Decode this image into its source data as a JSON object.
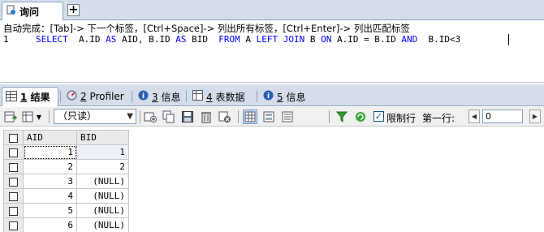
{
  "editor": {
    "tab_label": "询问",
    "new_tab_symbol": "+",
    "hint": "自动完成：[Tab]-> 下一个标签，[Ctrl+Space]-> 列出所有标签，[Ctrl+Enter]-> 列出匹配标签",
    "line_number": "1",
    "sql": {
      "t1": "SELECT",
      "t2": "  A.ID ",
      "t3": "AS",
      "t4": " AID, B.ID ",
      "t5": "AS",
      "t6": " BID  ",
      "t7": "FROM",
      "t8": " A ",
      "t9": "LEFT JOIN",
      "t10": " B ",
      "t11": "ON",
      "t12": " A.ID = B.ID ",
      "t13": "AND",
      "t14": "  B.ID<3"
    }
  },
  "result_tabs": [
    {
      "num": "1",
      "label": "结果",
      "icon": "grid-icon",
      "active": true
    },
    {
      "num": "2",
      "label": "Profiler",
      "icon": "profiler-icon",
      "active": false
    },
    {
      "num": "3",
      "label": "信息",
      "icon": "info-icon",
      "active": false
    },
    {
      "num": "4",
      "label": "表数据",
      "icon": "table-icon",
      "active": false
    },
    {
      "num": "5",
      "label": "信息",
      "icon": "info-icon",
      "active": false
    }
  ],
  "toolbar": {
    "mode_value": "（只读）",
    "limit_label": "限制行",
    "limit_checked": "✓",
    "first_row_label": "第一行:",
    "first_row_value": "0"
  },
  "grid": {
    "columns": [
      "AID",
      "BID"
    ],
    "rows": [
      [
        "1",
        "1"
      ],
      [
        "2",
        "2"
      ],
      [
        "3",
        "(NULL)"
      ],
      [
        "4",
        "(NULL)"
      ],
      [
        "5",
        "(NULL)"
      ],
      [
        "6",
        "(NULL)"
      ]
    ]
  }
}
